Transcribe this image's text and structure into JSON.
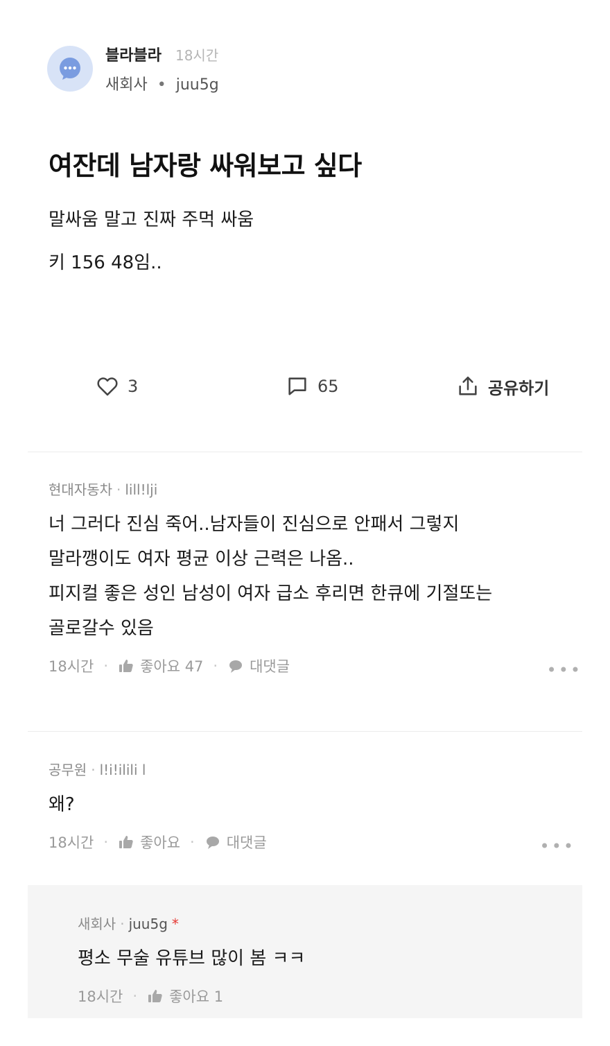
{
  "post": {
    "board": "블라블라",
    "time": "18시간",
    "company": "새회사",
    "separator": "•",
    "username": "juu5g",
    "title": "여잔데 남자랑 싸워보고 싶다",
    "body_lines": [
      "말싸움 말고 진짜 주먹 싸움",
      "키 156 48임.."
    ]
  },
  "actions": {
    "like_count": "3",
    "comment_count": "65",
    "share_label": "공유하기"
  },
  "comments": [
    {
      "company": "현대자동차",
      "username": "lill!lji",
      "lines": [
        "너 그러다 진심 죽어..남자들이 진심으로 안패서 그렇지",
        "말라깽이도 여자 평균 이상 근력은 나옴..",
        "피지컬 좋은 성인 남성이 여자 급소 후리면 한큐에 기절또는",
        "골로갈수 있음"
      ],
      "time": "18시간",
      "like_label": "좋아요 47",
      "reply_label": "대댓글"
    },
    {
      "company": "공무원",
      "username": "l!i!ilili l",
      "lines": [
        "왜?"
      ],
      "time": "18시간",
      "like_label": "좋아요",
      "reply_label": "대댓글"
    }
  ],
  "reply": {
    "company": "새회사",
    "username": "juu5g",
    "author_mark": "*",
    "text": "평소 무술 유튜브 많이 봄 ㅋㅋ",
    "time": "18시간",
    "like_label": "좋아요 1"
  },
  "ui": {
    "meta_sep": "·",
    "more_glyph": "•••"
  },
  "colors": {
    "avatar_bg": "#d8e3f7",
    "avatar_icon": "#7a9ce0",
    "reply_bg": "#f5f5f5",
    "author_mark": "#e53935"
  }
}
